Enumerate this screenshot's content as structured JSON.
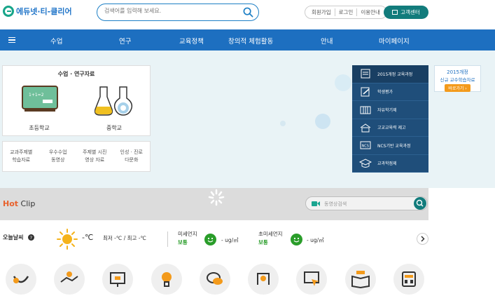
{
  "header": {
    "logo_text": "에듀넷·티-클리어",
    "search_placeholder": "검색어를 입력해 보세요.",
    "links": [
      "회원가입",
      "로그인",
      "이용안내"
    ],
    "cs_label": "고객센터"
  },
  "nav": {
    "items": [
      "수업",
      "연구",
      "교육정책",
      "창의적 체험활동",
      "안내",
      "마이페이지"
    ]
  },
  "materials": {
    "title": "수업 · 연구자료",
    "elementary": "초등학교",
    "middle": "중학교",
    "links": [
      {
        "line1": "교과주제별",
        "line2": "학습자료"
      },
      {
        "line1": "우수수업",
        "line2": "동영상"
      },
      {
        "line1": "주제별 시진",
        "line2": "영상 자료"
      },
      {
        "line1": "인성 · 진로",
        "line2": "다문화"
      }
    ]
  },
  "side_menu": {
    "items": [
      "2015개정 교육과정",
      "학생평가",
      "자유학기제",
      "고교교육력 제고",
      "NCS기반 교육과정",
      "교과학점제"
    ]
  },
  "promo": {
    "line1": "2015개정",
    "line2": "신규 교수학습자료",
    "button": "바로가기 ›"
  },
  "hotclip": {
    "hot": "Hot",
    "clip": "Clip",
    "search_placeholder": "동영상검색"
  },
  "weather": {
    "label": "오늘날씨",
    "temp_unit": "-℃",
    "range": "최저 -℃ / 최고 -℃",
    "fine_dust_label": "미세먼지",
    "fine_dust_status": "보통",
    "fine_dust_value": "- ug/㎥",
    "ultra_dust_label": "초미세먼지",
    "ultra_dust_status": "보통",
    "ultra_dust_value": "- ug/㎥"
  },
  "colors": {
    "nav_blue": "#1d6fc0",
    "side_navy": "#1f4e7a",
    "accent_teal": "#127c7c",
    "hot_orange": "#e8612c",
    "status_green": "#2a9d2a"
  },
  "icons": [
    "smile-icon",
    "handshake-icon",
    "monitor-board-icon",
    "lightbulb-icon",
    "speech-bubbles-icon",
    "map-pin-icon",
    "touch-screen-icon",
    "open-book-icon",
    "calculator-icon"
  ]
}
